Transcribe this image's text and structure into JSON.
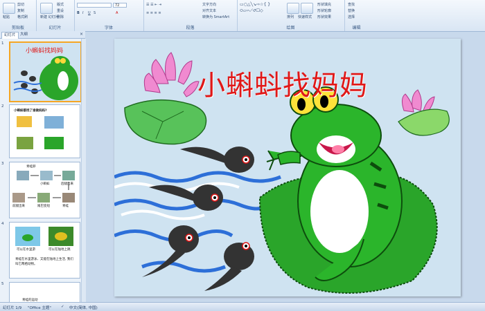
{
  "ribbon": {
    "clipboard": {
      "paste": "粘贴",
      "cut": "剪切",
      "copy": "复制",
      "format_painter": "格式刷",
      "label": "剪贴板"
    },
    "slides": {
      "new_slide": "新建\n幻灯片",
      "layout": "版式",
      "reset": "重设",
      "delete": "删除",
      "label": "幻灯片"
    },
    "font": {
      "name": "",
      "size": "72",
      "label": "字体"
    },
    "paragraph": {
      "text_direction": "文字方向",
      "align_text": "对齐文本",
      "convert_smartart": "转换为 SmartArt",
      "label": "段落"
    },
    "drawing": {
      "arrange": "排列",
      "quick_styles": "快速样式",
      "shape_fill": "形状填充",
      "shape_outline": "形状轮廓",
      "shape_effects": "形状效果",
      "label": "绘图"
    },
    "editing": {
      "find": "查找",
      "replace": "替换",
      "select": "选择",
      "label": "编辑"
    }
  },
  "panel_tabs": {
    "slides": "幻灯片",
    "outline": "大纲"
  },
  "thumbnails": [
    {
      "num": "1",
      "title": "小蝌蚪找妈妈"
    },
    {
      "num": "2",
      "question": "小蝌蚪都找了谁做妈妈?"
    },
    {
      "num": "3",
      "lines": [
        "青蛙卵",
        "小蝌蚪",
        "后腿出来",
        "前腿出来",
        "尾巴变短",
        "青蛙"
      ]
    },
    {
      "num": "4",
      "cap1": "可以在水里游",
      "cap2": "可以在陆地上跳",
      "body": "青蛙在水里游泳、又能在陆地上生活, 我们叫它两栖动物。"
    },
    {
      "num": "5",
      "cap": "青蛙的运动"
    }
  ],
  "slide": {
    "title": "小蝌蚪找妈妈"
  },
  "status": {
    "slide_count": "幻灯片 1/9",
    "theme": "\"Office 主题\"",
    "language": "中文(简体, 中国)"
  }
}
